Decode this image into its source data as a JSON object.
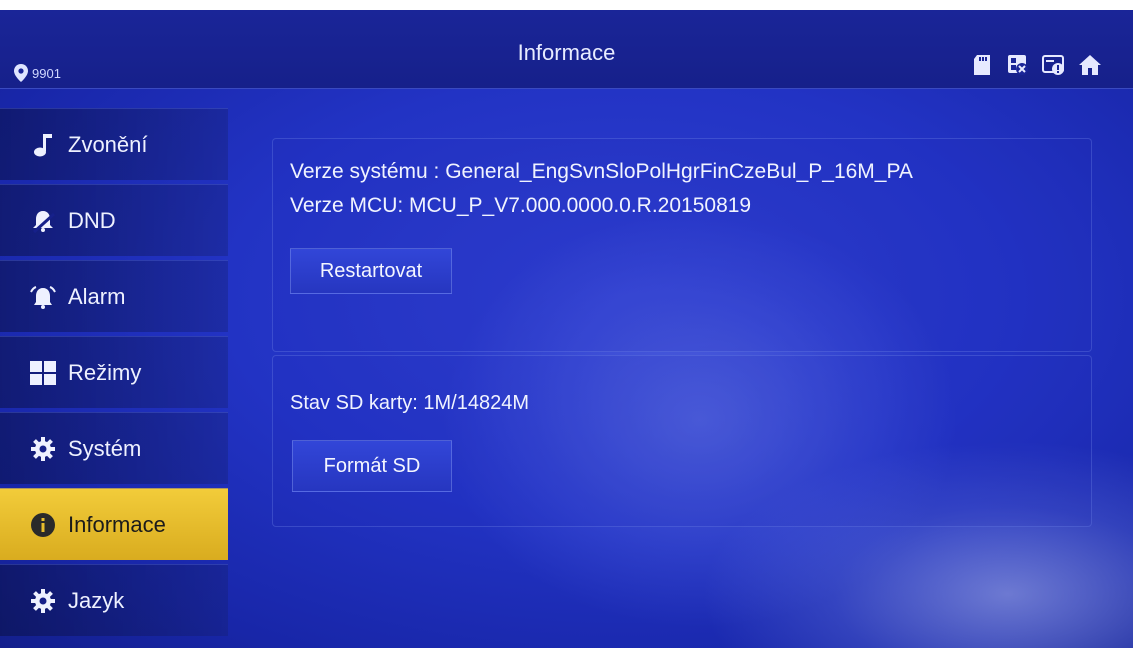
{
  "header": {
    "location": "9901",
    "title": "Informace",
    "status_icons": [
      "sd-card-icon",
      "network-error-icon",
      "card-info-icon",
      "home-icon"
    ]
  },
  "sidebar": {
    "items": [
      {
        "label": "Zvonění",
        "icon": "music-note-icon"
      },
      {
        "label": "DND",
        "icon": "bell-mute-icon"
      },
      {
        "label": "Alarm",
        "icon": "alarm-icon"
      },
      {
        "label": "Režimy",
        "icon": "modes-grid-icon"
      },
      {
        "label": "Systém",
        "icon": "gear-icon"
      },
      {
        "label": "Informace",
        "icon": "info-icon",
        "active": true
      },
      {
        "label": "Jazyk",
        "icon": "gear-icon"
      }
    ]
  },
  "info": {
    "system_version": "Verze systému  : General_EngSvnSloPolHgrFinCzeBul_P_16M_PA",
    "mcu_version": "Verze MCU: MCU_P_V7.000.0000.0.R.20150819",
    "restart_label": "Restartovat",
    "sd_status": "Stav SD karty: 1M/14824M",
    "format_label": "Formát SD"
  },
  "colors": {
    "background": "#2233c4",
    "active_item": "#e8bd2c",
    "text": "#f0f3ff"
  }
}
